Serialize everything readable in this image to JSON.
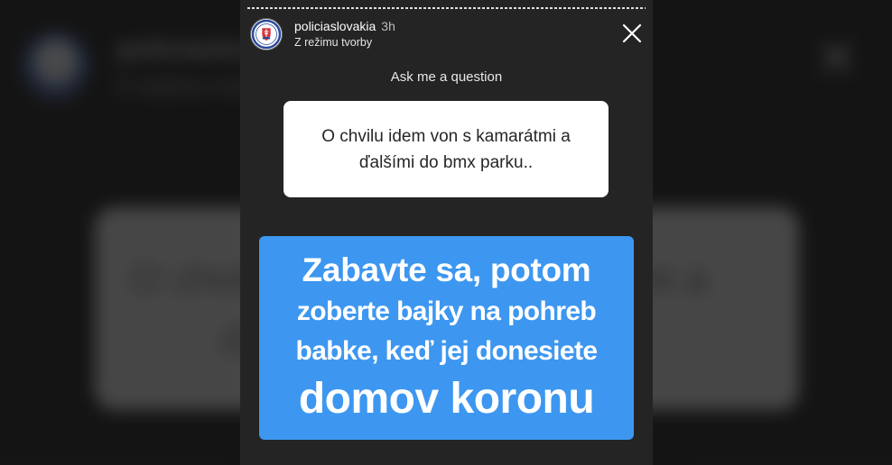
{
  "story": {
    "username": "policiaslovakia",
    "time": "3h",
    "mode": "Z režimu tvorby",
    "close_icon": "close-icon",
    "question_prompt": "Ask me a question",
    "question_text_line1": "O chvilu idem von s kamarátmi a",
    "question_text_line2": "ďalšími do bmx parku..",
    "answer_line1": "Zabavte sa, potom",
    "answer_line2": "zoberte bajky na pohreb",
    "answer_line3": "babke, keď jej donesiete",
    "answer_line4": "domov koronu"
  },
  "colors": {
    "answer_background": "#3d97f0",
    "story_background": "#242424",
    "question_card": "#ffffff"
  }
}
